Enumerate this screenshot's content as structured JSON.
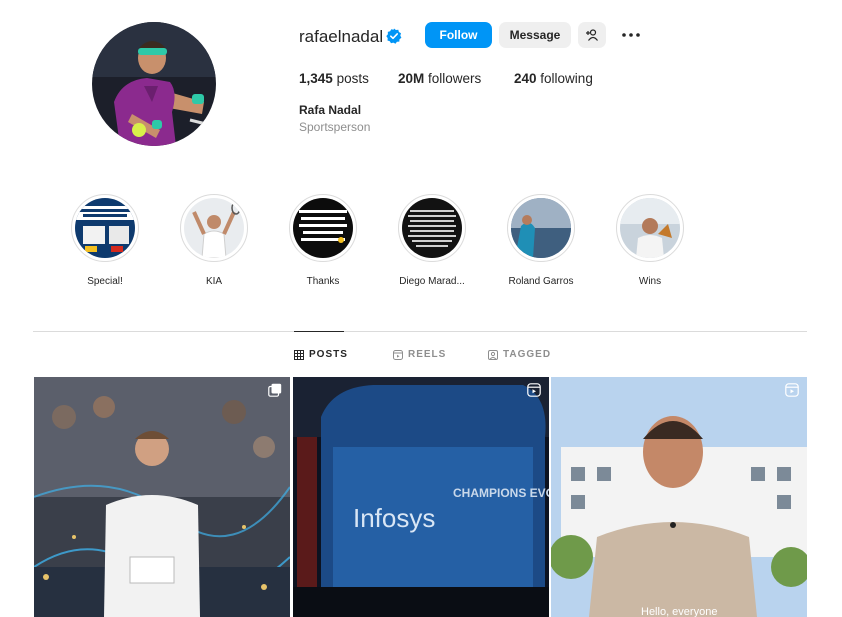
{
  "profile": {
    "username": "rafaelnadal",
    "full_name": "Rafa Nadal",
    "category": "Sportsperson"
  },
  "actions": {
    "follow_label": "Follow",
    "message_label": "Message"
  },
  "stats": {
    "posts_count": "1,345",
    "posts_label": "posts",
    "followers_count": "20M",
    "followers_label": "followers",
    "following_count": "240",
    "following_label": "following"
  },
  "highlights": [
    {
      "label": "Special!"
    },
    {
      "label": "KIA"
    },
    {
      "label": "Thanks"
    },
    {
      "label": "Diego Marad..."
    },
    {
      "label": "Roland Garros"
    },
    {
      "label": "Wins"
    }
  ],
  "tabs": [
    {
      "label": "POSTS",
      "active": true
    },
    {
      "label": "REELS",
      "active": false
    },
    {
      "label": "TAGGED",
      "active": false
    }
  ],
  "posts": [
    {
      "kind": "carousel"
    },
    {
      "kind": "reel",
      "brand_text": "Infosys",
      "billboard_text": "CHAMPIONS EVOLVE"
    },
    {
      "kind": "reel",
      "caption": "Hello, everyone"
    }
  ],
  "colors": {
    "accent": "#0095f6",
    "secondary_bg": "#efefef",
    "divider": "#dbdbdb",
    "muted_text": "#8e8e8e"
  }
}
